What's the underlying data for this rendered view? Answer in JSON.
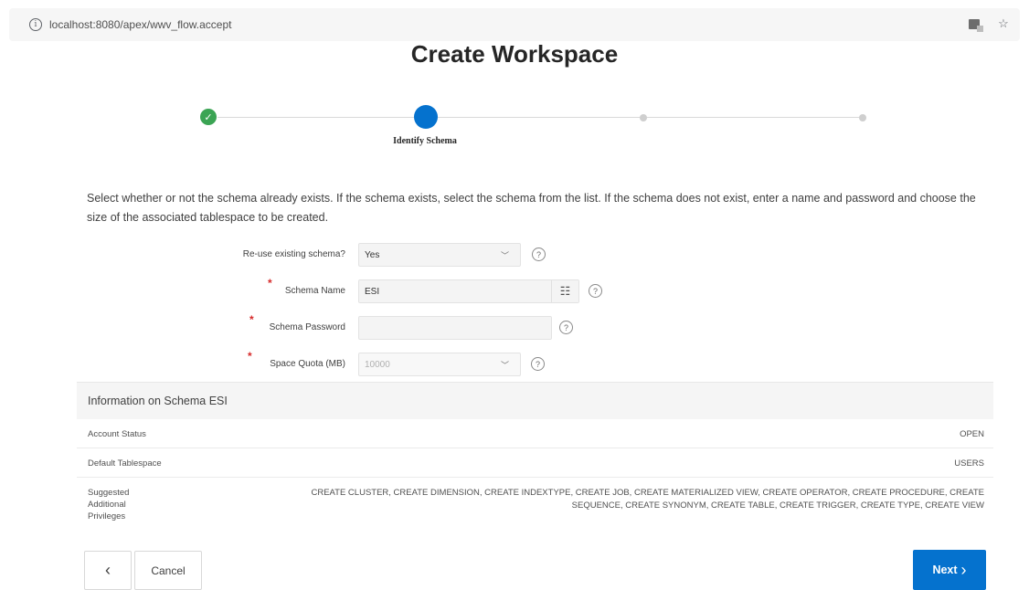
{
  "browser": {
    "url": "localhost:8080/apex/wwv_flow.accept"
  },
  "page": {
    "title": "Create Workspace"
  },
  "progress": {
    "current_step_label": "Identify Schema"
  },
  "description": "Select whether or not the schema already exists. If the schema exists, select the schema from the list. If the schema does not exist, enter a name and password and choose the size of the associated tablespace to be created.",
  "form": {
    "reuse": {
      "label": "Re-use existing schema?",
      "value": "Yes"
    },
    "schema_name": {
      "label": "Schema Name",
      "value": "ESI"
    },
    "schema_password": {
      "label": "Schema Password",
      "value": ""
    },
    "space_quota": {
      "label": "Space Quota (MB)",
      "value": "10000"
    }
  },
  "info": {
    "heading": "Information on Schema ESI",
    "rows": [
      {
        "key": "Account Status",
        "value": "OPEN"
      },
      {
        "key": "Default Tablespace",
        "value": "USERS"
      },
      {
        "key": "Suggested Additional Privileges",
        "value_line1": "CREATE CLUSTER, CREATE DIMENSION, CREATE INDEXTYPE, CREATE JOB, CREATE MATERIALIZED VIEW, CREATE OPERATOR, CREATE PROCEDURE, CREATE",
        "value_line2": "SEQUENCE, CREATE SYNONYM, CREATE TABLE, CREATE TRIGGER, CREATE TYPE, CREATE VIEW"
      }
    ]
  },
  "buttons": {
    "back_glyph": "‹",
    "cancel": "Cancel",
    "next": "Next",
    "next_glyph": "›"
  },
  "colors": {
    "accent": "#0572ce",
    "success": "#3ba454",
    "required": "#d62a2a"
  }
}
